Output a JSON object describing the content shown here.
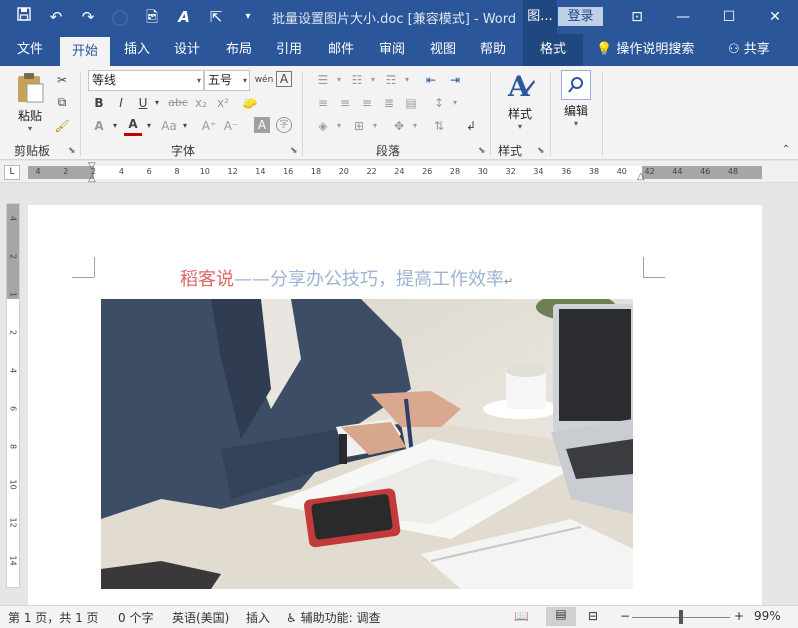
{
  "titlebar": {
    "qat_icons": [
      "save-icon",
      "undo-icon",
      "redo-icon",
      "circle-icon",
      "image-icon",
      "text-effects-icon",
      "cursor-icon",
      "customize-icon"
    ],
    "title": "批量设置图片大小.doc [兼容模式]  -  Word",
    "context_tab_title": "图...",
    "login": "登录",
    "window_controls": {
      "ribbon_options": "⊡",
      "minimize": "—",
      "maximize": "☐",
      "close": "✕"
    }
  },
  "tabs": {
    "items": [
      "文件",
      "开始",
      "插入",
      "设计",
      "布局",
      "引用",
      "邮件",
      "审阅",
      "视图",
      "帮助",
      "格式"
    ],
    "active": "开始",
    "tell_me": "操作说明搜索",
    "share": "共享"
  },
  "ribbon": {
    "clipboard": {
      "paste": "粘贴",
      "label": "剪贴板"
    },
    "font": {
      "font_name": "等线",
      "font_size": "五号",
      "wen": "wén",
      "a_box": "A",
      "bold": "B",
      "italic": "I",
      "underline": "U",
      "strike": "abc",
      "subscript": "x₂",
      "superscript": "x²",
      "text_effects": "A",
      "font_color": "A",
      "change_case": "Aa",
      "grow": "A⁺",
      "shrink": "A⁻",
      "char_shading": "A",
      "enclose": "字",
      "label": "字体"
    },
    "paragraph": {
      "label": "段落"
    },
    "styles": {
      "button": "样式",
      "label": "样式"
    },
    "editing": {
      "button": "编辑"
    }
  },
  "ruler": {
    "tab_selector": "L",
    "h_numbers": [
      "4",
      "2",
      "2",
      "4",
      "6",
      "8",
      "10",
      "12",
      "14",
      "16",
      "18",
      "20",
      "22",
      "24",
      "26",
      "28",
      "30",
      "32",
      "34",
      "36",
      "38",
      "40",
      "42",
      "44",
      "46",
      "48"
    ],
    "v_numbers": [
      "4",
      "2",
      "1",
      "2",
      "4",
      "6",
      "8",
      "10",
      "12",
      "14"
    ]
  },
  "document": {
    "heading_red": "稻客说",
    "heading_blue": "——分享办公技巧，提高工作效率",
    "pilcrow": "↵"
  },
  "statusbar": {
    "page": "第 1 页，共 1 页",
    "words": "0 个字",
    "language": "英语(美国)",
    "insert_mode": "插入",
    "accessibility": "辅助功能: 调查",
    "zoom_minus": "−",
    "zoom_plus": "+",
    "zoom": "99%",
    "zoom_level": 0.5
  },
  "colors": {
    "brand": "#2b579a",
    "heading_red": "#e06666",
    "heading_blue": "#9db3d6"
  }
}
